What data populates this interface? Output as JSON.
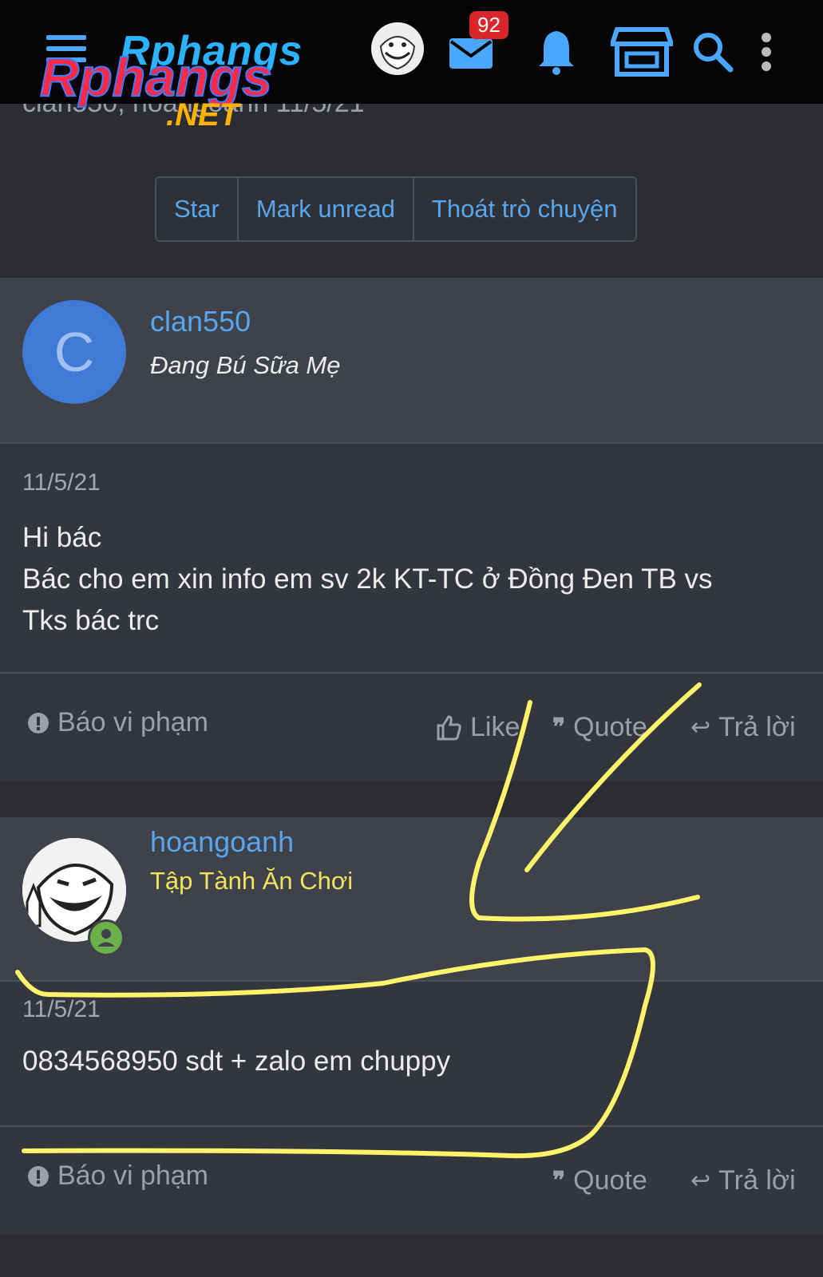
{
  "header": {
    "logo_top": "Rphangs",
    "logo_main": "Rphangs",
    "logo_suffix": ".NET",
    "badge_count": "92"
  },
  "conversation": {
    "meta_fragment": "clan550, hoangoanh   11/5/21"
  },
  "toolbar": {
    "star_label": "Star",
    "mark_unread_label": "Mark unread",
    "leave_label": "Thoát trò chuyện"
  },
  "messages": [
    {
      "username": "clan550",
      "user_title": "Đang Bú Sữa Mẹ",
      "avatar_letter": "C",
      "date": "11/5/21",
      "lines": [
        "Hi bác",
        "Bác cho em xin info em sv 2k KT-TC ở Đồng Đen TB vs",
        "Tks bác trc"
      ],
      "report": "Báo vi phạm",
      "like": "Like",
      "quote": "Quote",
      "reply": "Trả lời"
    },
    {
      "username": "hoangoanh",
      "user_title": "Tập Tành Ăn Chơi",
      "date": "11/5/21",
      "lines": [
        "0834568950 sdt + zalo em chuppy"
      ],
      "report": "Báo vi phạm",
      "quote": "Quote",
      "reply": "Trả lời"
    }
  ],
  "colors": {
    "link_blue": "#58a6ee",
    "title_yellow": "#f2e35c",
    "annotation_yellow": "#fff36b"
  }
}
